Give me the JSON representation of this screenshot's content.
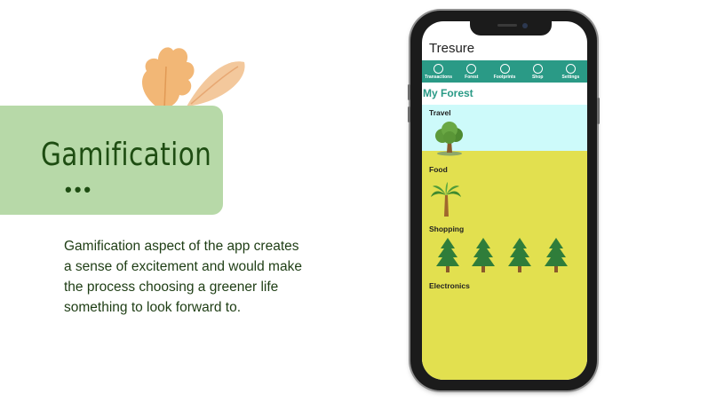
{
  "slide": {
    "title": "Gamification",
    "dots": "•••",
    "body_lines": [
      "Gamification aspect of the app creates",
      "a sense of excitement and would make",
      "the process choosing a greener life",
      "something to look forward to."
    ]
  },
  "app": {
    "title": "Tresure",
    "tabs": [
      {
        "label": "Transactions",
        "icon": "transactions-icon"
      },
      {
        "label": "Forest",
        "icon": "forest-icon"
      },
      {
        "label": "Footprints",
        "icon": "footprints-icon"
      },
      {
        "label": "Shop",
        "icon": "shop-icon"
      },
      {
        "label": "Settings",
        "icon": "settings-icon"
      }
    ],
    "forest_title": "My Forest",
    "categories": [
      {
        "label": "Travel",
        "tree_count": 1,
        "tree": "oak-tree-icon"
      },
      {
        "label": "Food",
        "tree_count": 1,
        "tree": "palm-tree-icon"
      },
      {
        "label": "Shopping",
        "tree_count": 4,
        "tree": "pine-tree-icon"
      },
      {
        "label": "Electronics",
        "tree_count": 0
      }
    ]
  },
  "colors": {
    "title_card": "#b7d9a8",
    "title_text": "#1e4d12",
    "tab_bar": "#2a9a86",
    "travel_band": "#cdfafa",
    "forest_background": "#e2e04f"
  }
}
